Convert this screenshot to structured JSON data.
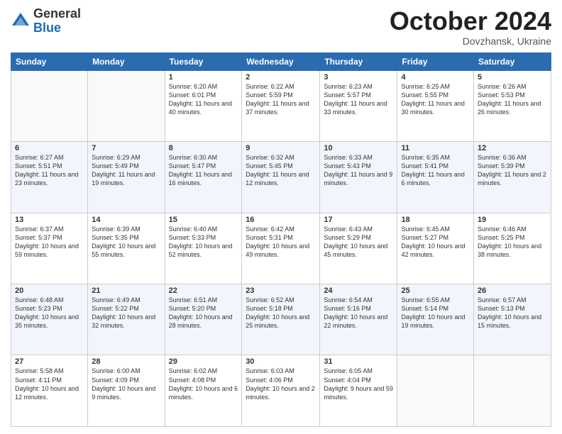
{
  "header": {
    "logo_general": "General",
    "logo_blue": "Blue",
    "month": "October 2024",
    "location": "Dovzhansk, Ukraine"
  },
  "days_of_week": [
    "Sunday",
    "Monday",
    "Tuesday",
    "Wednesday",
    "Thursday",
    "Friday",
    "Saturday"
  ],
  "weeks": [
    [
      {
        "day": "",
        "info": ""
      },
      {
        "day": "",
        "info": ""
      },
      {
        "day": "1",
        "info": "Sunrise: 6:20 AM\nSunset: 6:01 PM\nDaylight: 11 hours and 40 minutes."
      },
      {
        "day": "2",
        "info": "Sunrise: 6:22 AM\nSunset: 5:59 PM\nDaylight: 11 hours and 37 minutes."
      },
      {
        "day": "3",
        "info": "Sunrise: 6:23 AM\nSunset: 5:57 PM\nDaylight: 11 hours and 33 minutes."
      },
      {
        "day": "4",
        "info": "Sunrise: 6:25 AM\nSunset: 5:55 PM\nDaylight: 11 hours and 30 minutes."
      },
      {
        "day": "5",
        "info": "Sunrise: 6:26 AM\nSunset: 5:53 PM\nDaylight: 11 hours and 26 minutes."
      }
    ],
    [
      {
        "day": "6",
        "info": "Sunrise: 6:27 AM\nSunset: 5:51 PM\nDaylight: 11 hours and 23 minutes."
      },
      {
        "day": "7",
        "info": "Sunrise: 6:29 AM\nSunset: 5:49 PM\nDaylight: 11 hours and 19 minutes."
      },
      {
        "day": "8",
        "info": "Sunrise: 6:30 AM\nSunset: 5:47 PM\nDaylight: 11 hours and 16 minutes."
      },
      {
        "day": "9",
        "info": "Sunrise: 6:32 AM\nSunset: 5:45 PM\nDaylight: 11 hours and 12 minutes."
      },
      {
        "day": "10",
        "info": "Sunrise: 6:33 AM\nSunset: 5:43 PM\nDaylight: 11 hours and 9 minutes."
      },
      {
        "day": "11",
        "info": "Sunrise: 6:35 AM\nSunset: 5:41 PM\nDaylight: 11 hours and 6 minutes."
      },
      {
        "day": "12",
        "info": "Sunrise: 6:36 AM\nSunset: 5:39 PM\nDaylight: 11 hours and 2 minutes."
      }
    ],
    [
      {
        "day": "13",
        "info": "Sunrise: 6:37 AM\nSunset: 5:37 PM\nDaylight: 10 hours and 59 minutes."
      },
      {
        "day": "14",
        "info": "Sunrise: 6:39 AM\nSunset: 5:35 PM\nDaylight: 10 hours and 55 minutes."
      },
      {
        "day": "15",
        "info": "Sunrise: 6:40 AM\nSunset: 5:33 PM\nDaylight: 10 hours and 52 minutes."
      },
      {
        "day": "16",
        "info": "Sunrise: 6:42 AM\nSunset: 5:31 PM\nDaylight: 10 hours and 49 minutes."
      },
      {
        "day": "17",
        "info": "Sunrise: 6:43 AM\nSunset: 5:29 PM\nDaylight: 10 hours and 45 minutes."
      },
      {
        "day": "18",
        "info": "Sunrise: 6:45 AM\nSunset: 5:27 PM\nDaylight: 10 hours and 42 minutes."
      },
      {
        "day": "19",
        "info": "Sunrise: 6:46 AM\nSunset: 5:25 PM\nDaylight: 10 hours and 38 minutes."
      }
    ],
    [
      {
        "day": "20",
        "info": "Sunrise: 6:48 AM\nSunset: 5:23 PM\nDaylight: 10 hours and 35 minutes."
      },
      {
        "day": "21",
        "info": "Sunrise: 6:49 AM\nSunset: 5:22 PM\nDaylight: 10 hours and 32 minutes."
      },
      {
        "day": "22",
        "info": "Sunrise: 6:51 AM\nSunset: 5:20 PM\nDaylight: 10 hours and 28 minutes."
      },
      {
        "day": "23",
        "info": "Sunrise: 6:52 AM\nSunset: 5:18 PM\nDaylight: 10 hours and 25 minutes."
      },
      {
        "day": "24",
        "info": "Sunrise: 6:54 AM\nSunset: 5:16 PM\nDaylight: 10 hours and 22 minutes."
      },
      {
        "day": "25",
        "info": "Sunrise: 6:55 AM\nSunset: 5:14 PM\nDaylight: 10 hours and 19 minutes."
      },
      {
        "day": "26",
        "info": "Sunrise: 6:57 AM\nSunset: 5:13 PM\nDaylight: 10 hours and 15 minutes."
      }
    ],
    [
      {
        "day": "27",
        "info": "Sunrise: 5:58 AM\nSunset: 4:11 PM\nDaylight: 10 hours and 12 minutes."
      },
      {
        "day": "28",
        "info": "Sunrise: 6:00 AM\nSunset: 4:09 PM\nDaylight: 10 hours and 9 minutes."
      },
      {
        "day": "29",
        "info": "Sunrise: 6:02 AM\nSunset: 4:08 PM\nDaylight: 10 hours and 6 minutes."
      },
      {
        "day": "30",
        "info": "Sunrise: 6:03 AM\nSunset: 4:06 PM\nDaylight: 10 hours and 2 minutes."
      },
      {
        "day": "31",
        "info": "Sunrise: 6:05 AM\nSunset: 4:04 PM\nDaylight: 9 hours and 59 minutes."
      },
      {
        "day": "",
        "info": ""
      },
      {
        "day": "",
        "info": ""
      }
    ]
  ]
}
